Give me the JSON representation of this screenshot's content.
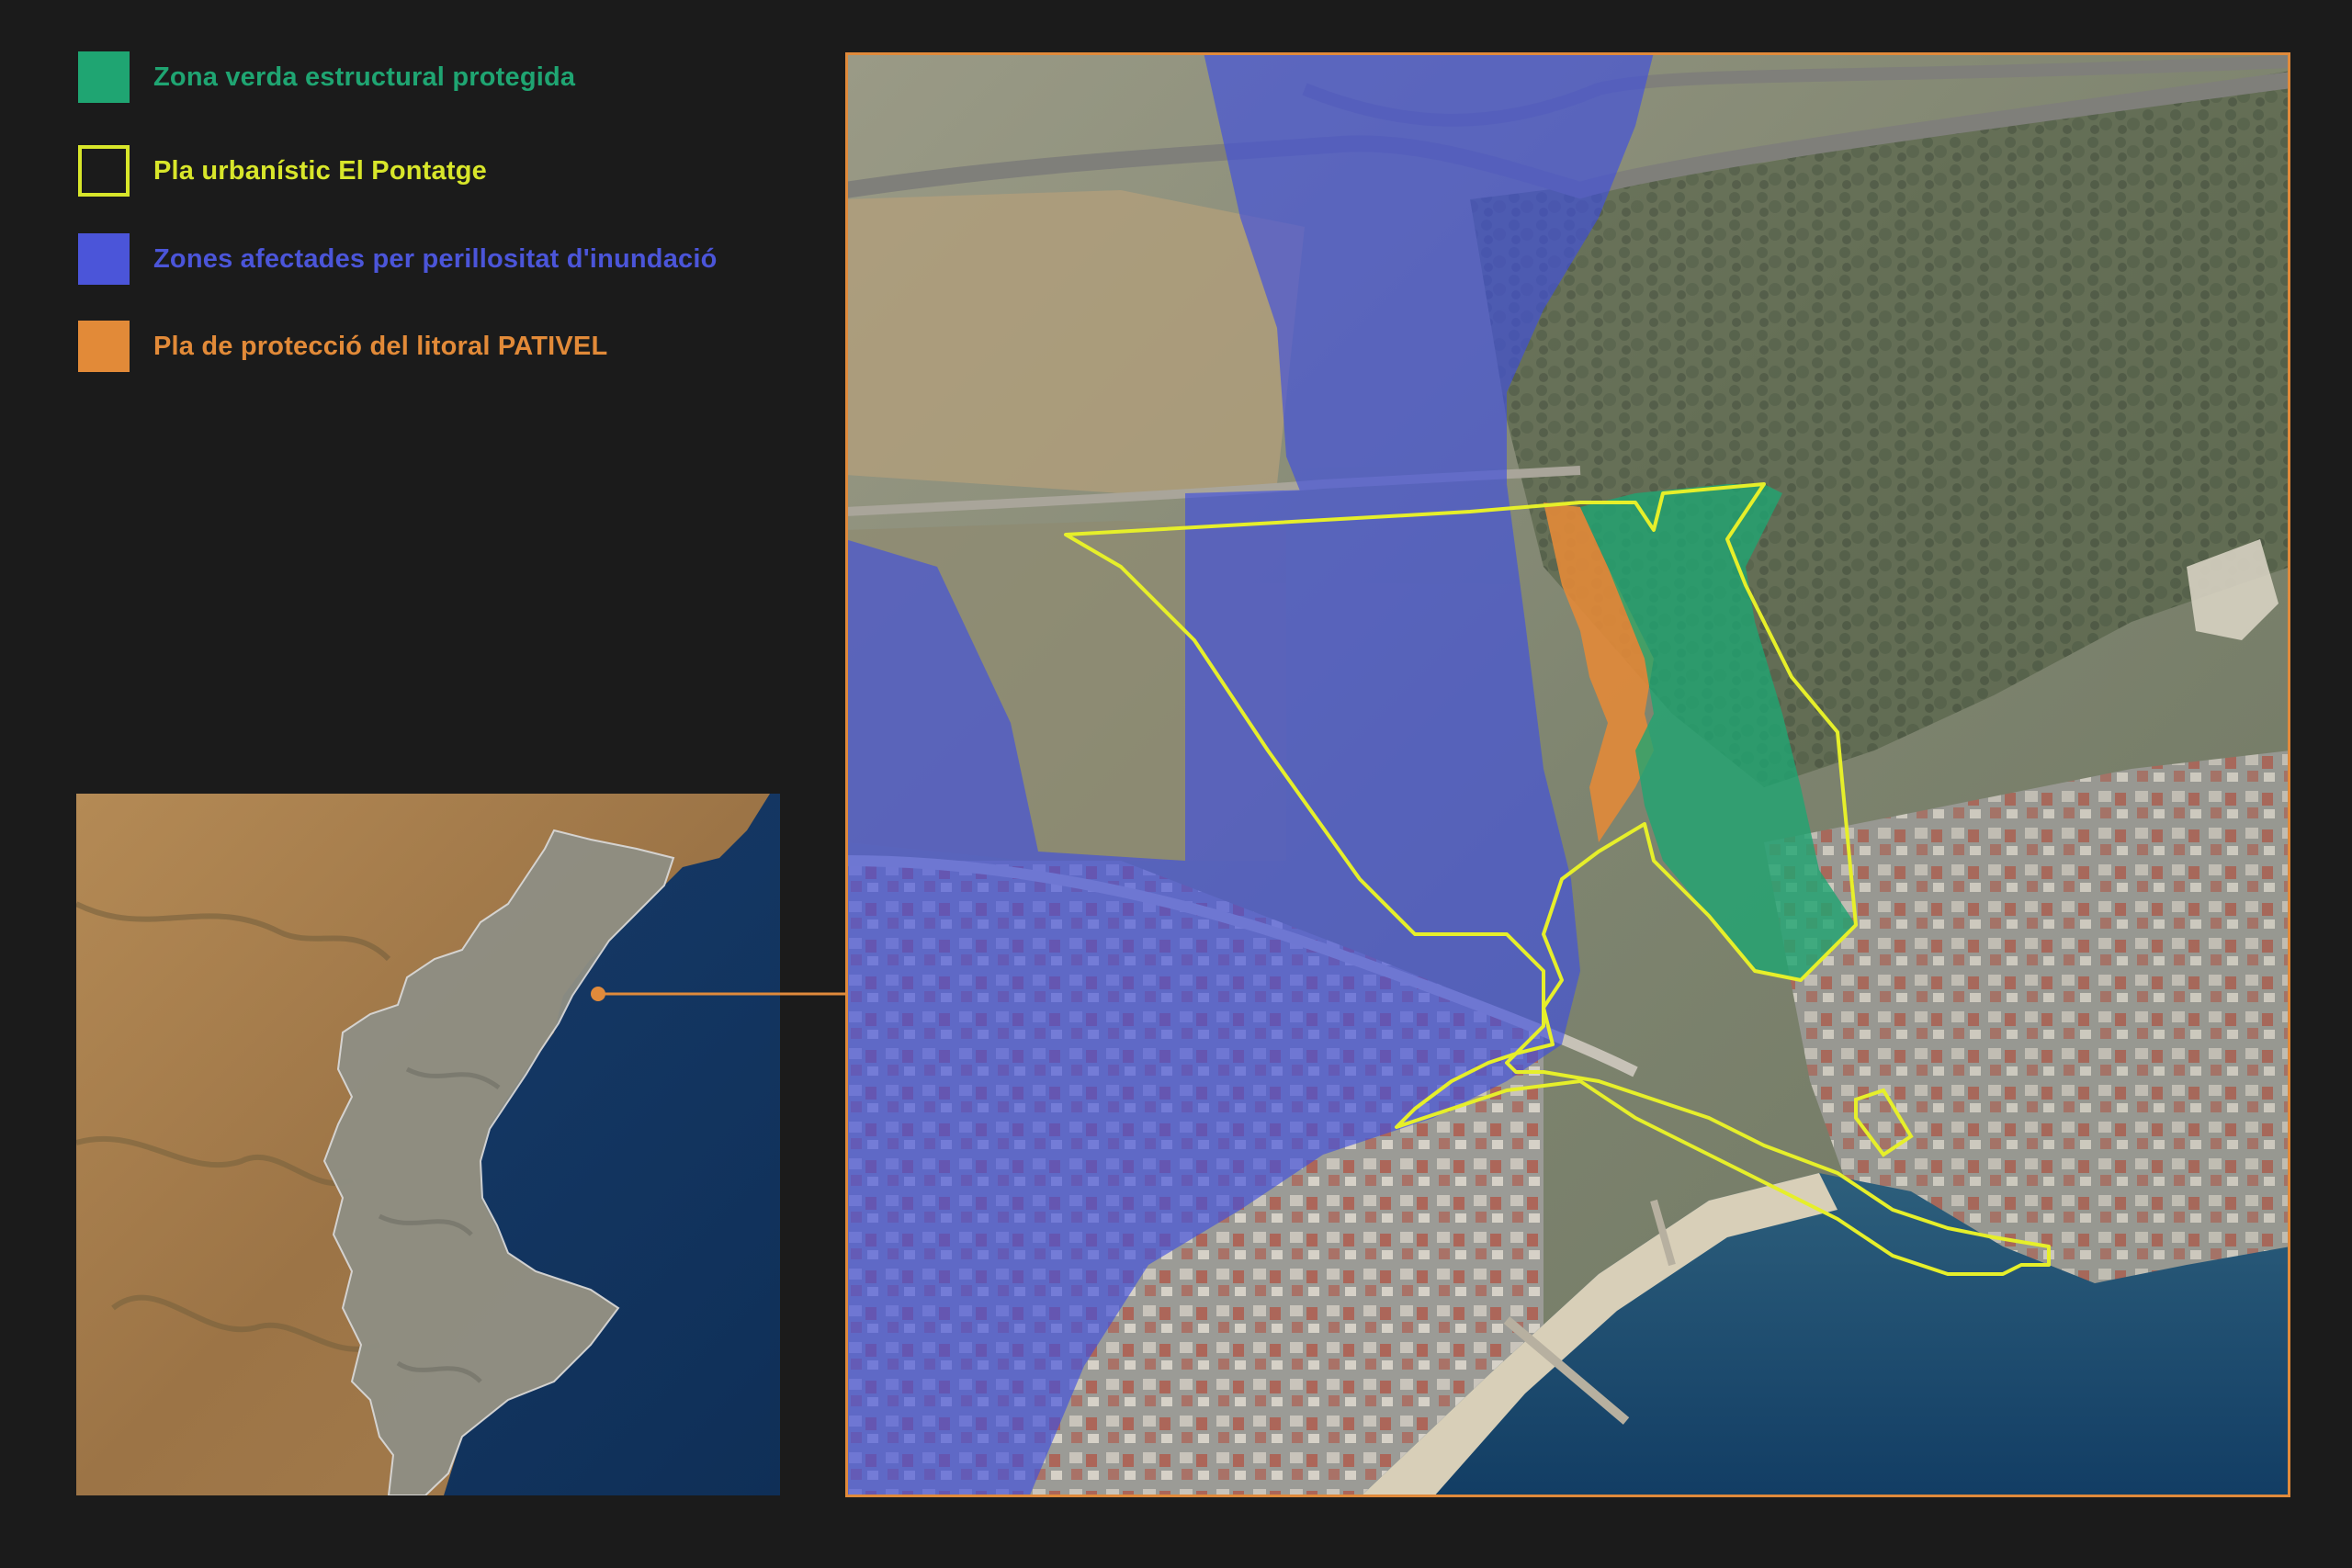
{
  "legend": {
    "items": [
      {
        "label": "Zona verda estructural protegida",
        "color": "#1fa572",
        "swatch": "filled"
      },
      {
        "label": "Pla urbanístic El Pontatge",
        "color": "#d8e62a",
        "swatch": "outline"
      },
      {
        "label": "Zones afectades per perillositat d'inundació",
        "color": "#4b55d9",
        "swatch": "filled"
      },
      {
        "label": "Pla de protecció del litoral PATIVEL",
        "color": "#e28a38",
        "swatch": "filled"
      }
    ]
  },
  "colors": {
    "background": "#1b1b1b",
    "frame": "#e08a3b",
    "connector": "#e08a3b",
    "sea": "#143a66",
    "land": "#8a8a7a"
  },
  "map_layers": {
    "green_zone": "Zona verda estructural protegida",
    "plan_boundary": "Pla urbanístic El Pontatge",
    "flood_zones": "Zones afectades per perillositat d'inundació",
    "pativel": "Pla de protecció del litoral PATIVEL"
  }
}
